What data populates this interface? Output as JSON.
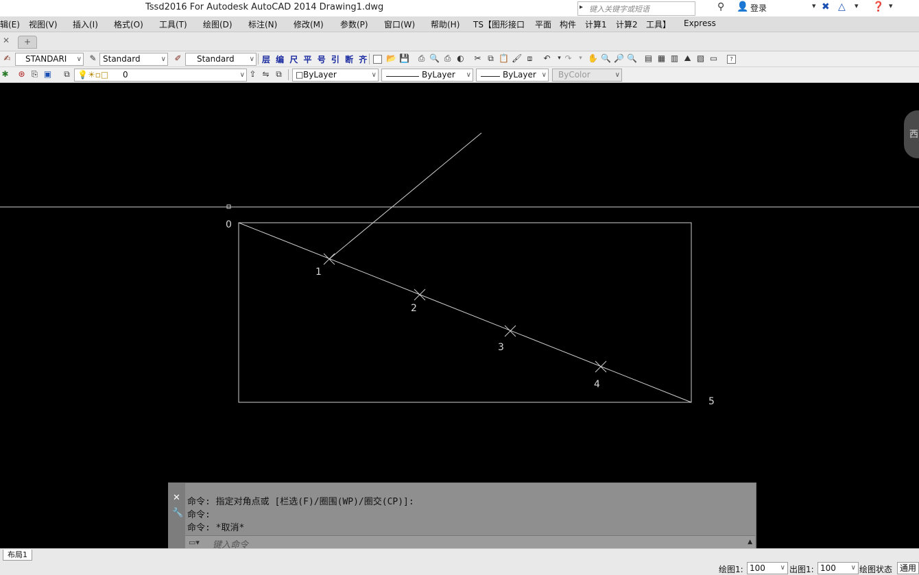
{
  "window": {
    "title": "Tssd2016 For Autodesk AutoCAD 2014    Drawing1.dwg",
    "search_placeholder": "键入关键字或短语",
    "login_label": "登录"
  },
  "menu": {
    "items": [
      "辑(E)",
      "视图(V)",
      "插入(I)",
      "格式(O)",
      "工具(T)",
      "绘图(D)",
      "标注(N)",
      "修改(M)",
      "参数(P)",
      "窗口(W)",
      "帮助(H)",
      "TS【图形接口",
      "平面",
      "构件",
      "计算1",
      "计算2",
      "工具】",
      "Express"
    ]
  },
  "toolbar": {
    "text_style": "STANDARI",
    "dim_style": "Standard",
    "table_style": "Standard",
    "ts_buttons": "层 编 尺 平 号 引 断 齐",
    "layer": "0",
    "color": "ByLayer",
    "linetype": "ByLayer",
    "lineweight": "ByLayer",
    "plotstyle": "ByColor"
  },
  "drawing": {
    "labels": [
      "0",
      "1",
      "2",
      "3",
      "4",
      "5"
    ],
    "viewcube_label": "西"
  },
  "command": {
    "history": [
      "命令: 指定对角点或 [栏选(F)/圈围(WP)/圈交(CP)]:",
      "命令:",
      "命令: *取消*"
    ],
    "input_placeholder": "键入命令"
  },
  "layout": {
    "tab": "布局1"
  },
  "status": {
    "draw_scale_label": "绘图1:",
    "draw_scale_value": "100",
    "plot_scale_label": "出图1:",
    "plot_scale_value": "100",
    "state_label": "绘图状态",
    "general_button": "通用"
  }
}
